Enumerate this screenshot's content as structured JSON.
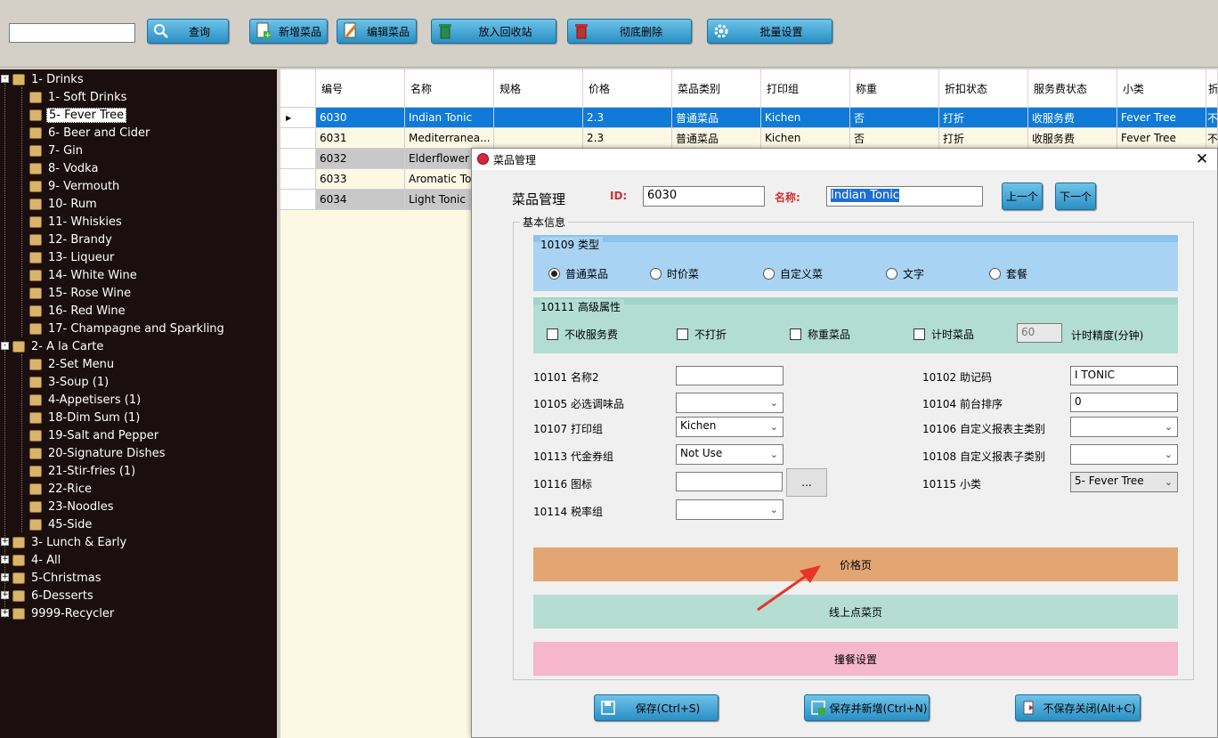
{
  "toolbar": {
    "search_value": "",
    "buttons": [
      {
        "label": "查询",
        "icon": "search-icon"
      },
      {
        "label": "新增菜品",
        "icon": "add-document-icon"
      },
      {
        "label": "编辑菜品",
        "icon": "edit-pencil-icon"
      },
      {
        "label": "放入回收站",
        "icon": "recycle-bin-icon"
      },
      {
        "label": "彻底删除",
        "icon": "delete-bin-icon"
      },
      {
        "label": "批量设置",
        "icon": "gear-icon"
      }
    ]
  },
  "tree": {
    "nodes": [
      {
        "label": "1- Drinks"
      },
      {
        "label": "1- Soft Drinks"
      },
      {
        "label": "5- Fever Tree"
      },
      {
        "label": "6- Beer and Cider"
      },
      {
        "label": "7- Gin"
      },
      {
        "label": "8- Vodka"
      },
      {
        "label": "9- Vermouth"
      },
      {
        "label": "10- Rum"
      },
      {
        "label": "11- Whiskies"
      },
      {
        "label": "12- Brandy"
      },
      {
        "label": "13- Liqueur"
      },
      {
        "label": "14- White Wine"
      },
      {
        "label": "15- Rose Wine"
      },
      {
        "label": "16- Red Wine"
      },
      {
        "label": "17- Champagne and Sparkling"
      },
      {
        "label": "2- A la Carte"
      },
      {
        "label": "2-Set Menu"
      },
      {
        "label": "3-Soup (1)"
      },
      {
        "label": "4-Appetisers (1)"
      },
      {
        "label": "18-Dim Sum (1)"
      },
      {
        "label": "19-Salt and Pepper"
      },
      {
        "label": "20-Signature Dishes"
      },
      {
        "label": "21-Stir-fries (1)"
      },
      {
        "label": "22-Rice"
      },
      {
        "label": "23-Noodles"
      },
      {
        "label": "45-Side"
      },
      {
        "label": "3- Lunch & Early"
      },
      {
        "label": "4- All"
      },
      {
        "label": "5-Christmas"
      },
      {
        "label": "6-Desserts"
      },
      {
        "label": "9999-Recycler"
      }
    ]
  },
  "grid": {
    "columns": [
      "编号",
      "名称",
      "规格",
      "价格",
      "菜品类别",
      "打印组",
      "称重",
      "折扣状态",
      "服务费状态",
      "小类",
      "折"
    ],
    "rows": [
      [
        "6030",
        "Indian Tonic",
        "",
        "2.3",
        "普通菜品",
        "Kichen",
        "否",
        "打折",
        "收服务费",
        "Fever Tree",
        "不"
      ],
      [
        "6031",
        "Mediterranea...",
        "",
        "2.3",
        "普通菜品",
        "Kichen",
        "否",
        "打折",
        "收服务费",
        "Fever Tree",
        "不"
      ],
      [
        "6032",
        "Elderflower",
        "",
        "",
        "",
        "",
        "",
        "",
        "",
        "",
        ""
      ],
      [
        "6033",
        "Aromatic To",
        "",
        "",
        "",
        "",
        "",
        "",
        "",
        "",
        ""
      ],
      [
        "6034",
        "Light Tonic",
        "",
        "",
        "",
        "",
        "",
        "",
        "",
        "",
        ""
      ]
    ]
  },
  "dialog": {
    "title": "菜品管理",
    "header_label": "菜品管理",
    "id_label": "ID:",
    "id_value": "6030",
    "name_label": "名称:",
    "name_value": "Indian Tonic",
    "prev_label": "上一个",
    "next_label": "下一个",
    "basic_info_label": "基本信息",
    "type_section": {
      "title": "10109 类型",
      "options": [
        "普通菜品",
        "时价菜",
        "自定义菜",
        "文字",
        "套餐"
      ],
      "selected": "普通菜品"
    },
    "advanced_section": {
      "title": "10111 高级属性",
      "checkboxes": [
        "不收服务费",
        "不打折",
        "称重菜品",
        "计时菜品"
      ],
      "timer_value": "60",
      "timer_label": "计时精度(分钟)"
    },
    "fields_left": [
      {
        "label": "10101 名称2",
        "value": ""
      },
      {
        "label": "10105 必选调味品",
        "value": ""
      },
      {
        "label": "10107 打印组",
        "value": "Kichen"
      },
      {
        "label": "10113 代金券组",
        "value": "Not Use"
      },
      {
        "label": "10116 图标",
        "value": "",
        "browse": "..."
      },
      {
        "label": "10114 税率组",
        "value": ""
      }
    ],
    "fields_right": [
      {
        "label": "10102 助记码",
        "value": "I TONIC"
      },
      {
        "label": "10104 前台排序",
        "value": "0"
      },
      {
        "label": "10106 自定义报表主类别",
        "value": ""
      },
      {
        "label": "10108 自定义报表子类别",
        "value": ""
      },
      {
        "label": "10115 小类",
        "value": "5- Fever Tree"
      }
    ],
    "page_buttons": [
      {
        "label": "价格页",
        "color": "#e3a672"
      },
      {
        "label": "线上点菜页",
        "color": "#b5ddd1"
      },
      {
        "label": "撞餐设置",
        "color": "#f6b6cb"
      }
    ],
    "footer_buttons": [
      {
        "label": "保存(Ctrl+S)",
        "icon": "save-icon"
      },
      {
        "label": "保存并新增(Ctrl+N)",
        "icon": "save-add-icon"
      },
      {
        "label": "不保存关闭(Alt+C)",
        "icon": "exit-icon"
      }
    ]
  },
  "colors": {
    "tree_bg": "#1b0e0e",
    "selected_row": "#0f7ad8",
    "type_panel": "#a8d3f2",
    "advanced_panel": "#b2ddd2",
    "arrow": "#e8332a"
  }
}
